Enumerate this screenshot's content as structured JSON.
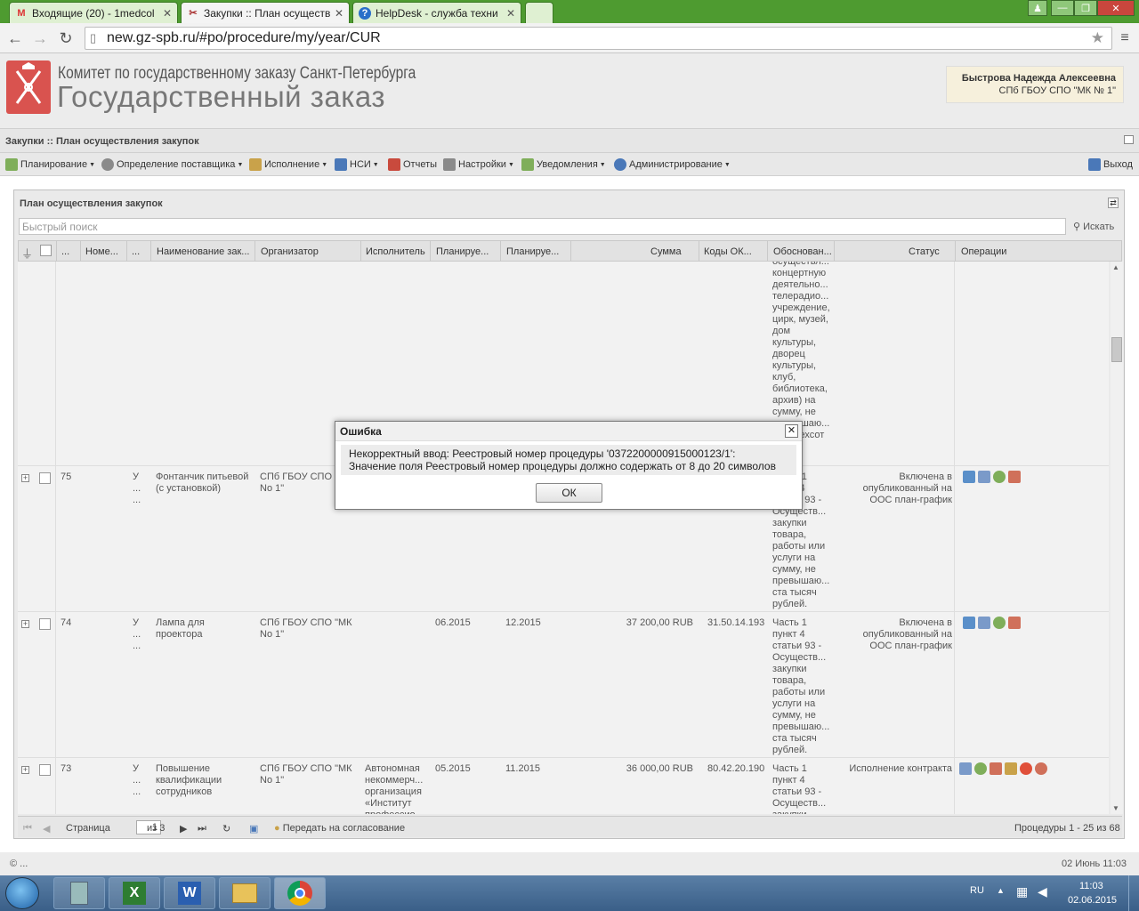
{
  "browser": {
    "tabs": [
      {
        "label": "Входящие (20) - 1medcol",
        "icon": "gmail-icon"
      },
      {
        "label": "Закупки :: План осуществ",
        "icon": "procurement-icon"
      },
      {
        "label": "HelpDesk - служба техни",
        "icon": "helpdesk-icon"
      }
    ],
    "url": "new.gz-spb.ru/#po/procedure/my/year/CUR"
  },
  "header": {
    "org_line": "Комитет по государственному заказу Санкт-Петербурга",
    "app_name": "Государственный заказ",
    "user_name": "Быстрова Надежда Алексеевна",
    "user_org": "СПб ГБОУ СПО \"МК № 1\""
  },
  "breadcrumb": "Закупки :: План осуществления закупок",
  "menu": {
    "planning": "Планирование",
    "supplier": "Определение поставщика",
    "execution": "Исполнение",
    "nsi": "НСИ",
    "reports": "Отчеты",
    "settings": "Настройки",
    "notifications": "Уведомления",
    "admin": "Администрирование",
    "exit": "Выход"
  },
  "panel": {
    "title": "План осуществления закупок",
    "search_placeholder": "Быстрый поиск",
    "search_button": "Искать"
  },
  "columns": {
    "dots1": "...",
    "number": "Номе...",
    "dots2": "...",
    "name": "Наименование зак...",
    "organizer": "Организатор",
    "executor": "Исполнитель",
    "plan1": "Планируе...",
    "plan2": "Планируе...",
    "sum": "Сумма",
    "codes": "Коды ОК...",
    "reason": "Обоснован...",
    "status": "Статус",
    "operations": "Операции"
  },
  "rows": [
    {
      "reason": "осуществл...\nконцертную\nдеятельно...\nтелерадио...\nучреждение,\nцирк, музей,\nдом\nкультуры,\nдворец\nкультуры,\nклуб,\nбиблиотека,\nархив) на\nсумму, не\nпревышаю...\nчетырехсот"
    },
    {
      "number": "75",
      "type": "У\n...\n...",
      "name": "Фонтанчик питьевой\n(с установкой)",
      "organizer": "СПб ГБОУ СПО \"МК\nNo 1\"",
      "executor": "",
      "plan1": "",
      "plan2": "",
      "sum": "",
      "codes": "",
      "reason": "Часть 1\nпункт 4\nстатьи 93 -\nОсуществ...\nзакупки\nтовара,\nработы или\nуслуги на\nсумму, не\nпревышаю...\nста тысяч\nрублей.",
      "status": "Включена в\nопубликованный на\nООС план-график"
    },
    {
      "number": "74",
      "type": "У\n...\n...",
      "name": "Лампа для\nпроектора",
      "organizer": "СПб ГБОУ СПО \"МК\nNo 1\"",
      "executor": "",
      "plan1": "06.2015",
      "plan2": "12.2015",
      "sum": "37 200,00 RUB",
      "codes": "31.50.14.193",
      "reason": "Часть 1\nпункт 4\nстатьи 93 -\nОсуществ...\nзакупки\nтовара,\nработы или\nуслуги на\nсумму, не\nпревышаю...\nста тысяч\nрублей.",
      "status": "Включена в\nопубликованный на\nООС план-график"
    },
    {
      "number": "73",
      "type": "У\n...\n...",
      "name": "Повышение\nквалификации\nсотрудников",
      "organizer": "СПб ГБОУ СПО \"МК\nNo 1\"",
      "executor": "Автономная\nнекоммерч...\nорганизация\n«Институт\nпрофессио...",
      "plan1": "05.2015",
      "plan2": "11.2015",
      "sum": "36 000,00 RUB",
      "codes": "80.42.20.190",
      "reason": "Часть 1\nпункт 4\nстатьи 93 -\nОсуществ...\nзакупки",
      "status": "Исполнение контракта"
    }
  ],
  "pager": {
    "page_label": "Страница",
    "page": "1",
    "of_pages": "из 3",
    "send_approval": "Передать на согласование",
    "summary": "Процедуры 1 - 25 из 68"
  },
  "footer": {
    "copyright": "© ...",
    "datetime": "02 Июнь 11:03"
  },
  "dialog": {
    "title": "Ошибка",
    "line1": "Некорректный ввод: Реестровый номер процедуры '0372200000915000123/1':",
    "line2": "Значение поля Реестровый номер процедуры должно содержать от 8 до 20 символов",
    "ok": "ОК"
  },
  "taskbar": {
    "lang": "RU",
    "time": "11:03",
    "date": "02.06.2015"
  },
  "colors": {
    "tabbar": "#4e9b30",
    "header_bg": "#ececec",
    "panel_bg": "#eaeaea",
    "logo_red": "#d9534f"
  }
}
